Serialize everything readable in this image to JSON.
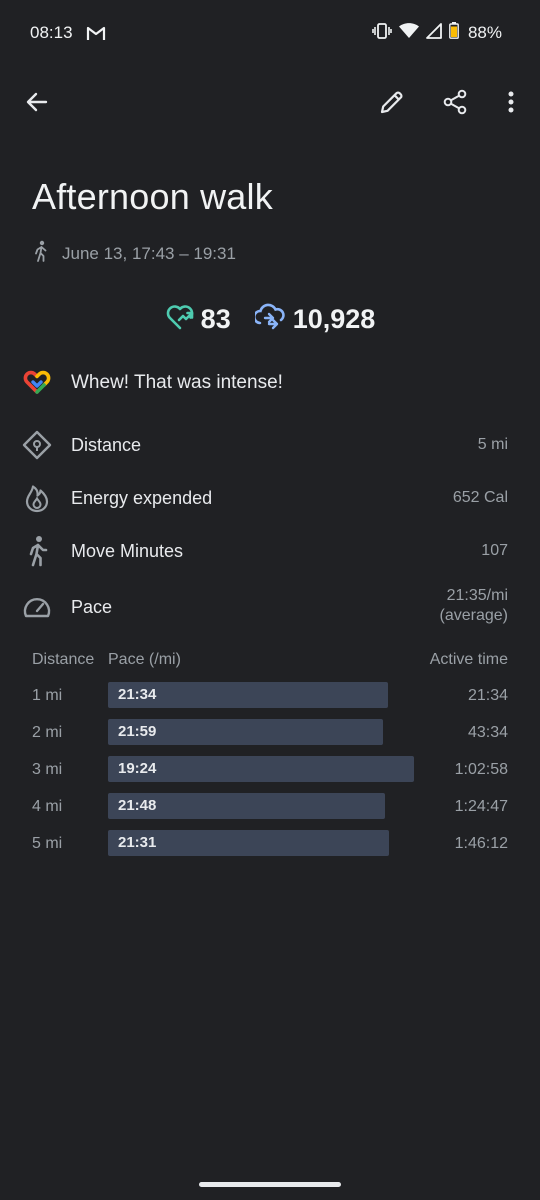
{
  "status_bar": {
    "time": "08:13",
    "battery": "88%"
  },
  "activity": {
    "title": "Afternoon walk",
    "date_range": "June 13, 17:43 – 19:31"
  },
  "goals": {
    "heart_points": "83",
    "steps": "10,928",
    "heart_color": "#4ecbb0",
    "steps_color": "#8ab4f8"
  },
  "message": "Whew! That was intense!",
  "metrics": {
    "distance": {
      "label": "Distance",
      "value": "5 mi"
    },
    "energy": {
      "label": "Energy expended",
      "value": "652 Cal"
    },
    "move_minutes": {
      "label": "Move Minutes",
      "value": "107"
    },
    "pace": {
      "label": "Pace",
      "value": "21:35/mi",
      "note": "(average)"
    }
  },
  "splits": {
    "headers": {
      "distance": "Distance",
      "pace": "Pace (/mi)",
      "active_time": "Active time"
    },
    "rows": [
      {
        "distance": "1 mi",
        "pace": "21:34",
        "active_time": "21:34",
        "pace_seconds": 1294
      },
      {
        "distance": "2 mi",
        "pace": "21:59",
        "active_time": "43:34",
        "pace_seconds": 1319
      },
      {
        "distance": "3 mi",
        "pace": "19:24",
        "active_time": "1:02:58",
        "pace_seconds": 1164
      },
      {
        "distance": "4 mi",
        "pace": "21:48",
        "active_time": "1:24:47",
        "pace_seconds": 1308
      },
      {
        "distance": "5 mi",
        "pace": "21:31",
        "active_time": "1:46:12",
        "pace_seconds": 1291
      }
    ]
  }
}
